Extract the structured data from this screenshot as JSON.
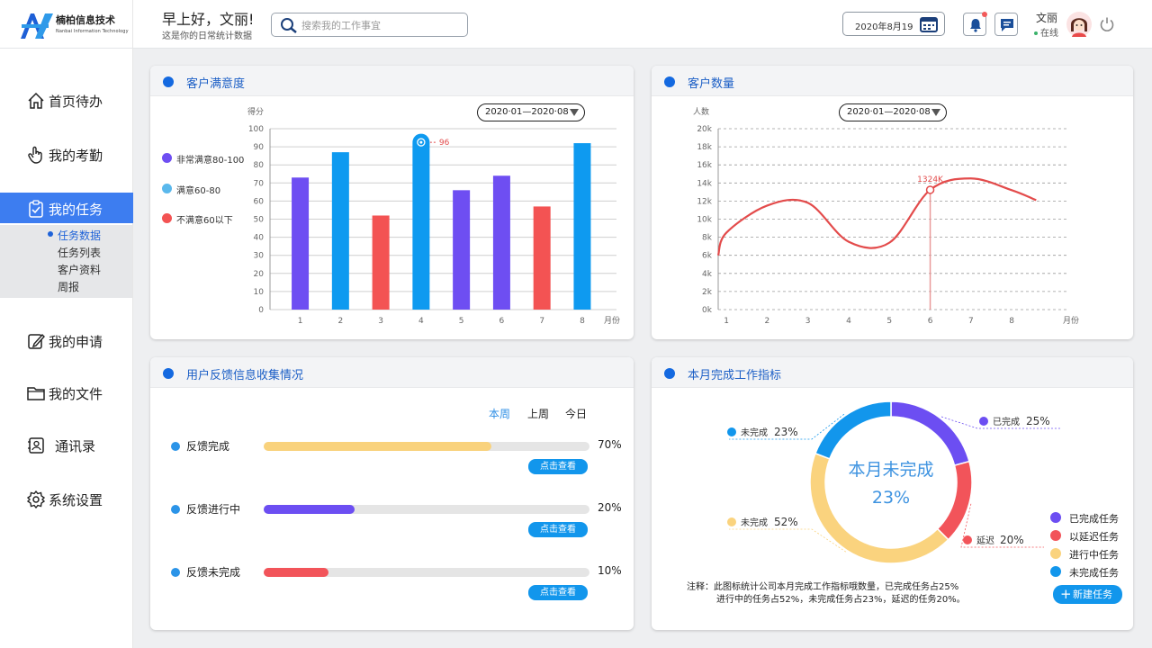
{
  "header": {
    "logo_name": "楠柏信息技术",
    "logo_sub": "Nanbai Information Technology",
    "greeting": "早上好，文丽!",
    "greeting_sub": "这是你的日常统计数据",
    "search_placeholder": "搜索我的工作事宜",
    "date": "2020年8月19",
    "user_name": "文丽",
    "user_status": "在线",
    "icons": [
      "search-icon",
      "calendar-icon",
      "bell-icon",
      "message-icon",
      "avatar",
      "power-icon"
    ]
  },
  "sidebar": {
    "items": [
      {
        "label": "首页待办",
        "icon": "home-icon"
      },
      {
        "label": "我的考勤",
        "icon": "hand-icon"
      },
      {
        "label": "我的任务",
        "icon": "task-icon"
      },
      {
        "label": "我的申请",
        "icon": "edit-icon"
      },
      {
        "label": "我的文件",
        "icon": "folder-icon"
      },
      {
        "label": "通讯录",
        "icon": "contacts-icon"
      },
      {
        "label": "系统设置",
        "icon": "gear-icon"
      }
    ],
    "active_index": 2,
    "sub_items": [
      "任务数据",
      "任务列表",
      "客户资料",
      "周报"
    ],
    "active_sub": 0
  },
  "cards": {
    "satisfaction": {
      "title": "客户满意度",
      "date_range": "2020·01—2020·08"
    },
    "customers": {
      "title": "客户数量",
      "date_range": "2020·01—2020·08"
    },
    "feedback": {
      "title": "用户反馈信息收集情况"
    },
    "monthly": {
      "title": "本月完成工作指标"
    }
  },
  "chart_data": [
    {
      "type": "bar",
      "title": "客户满意度",
      "ylabel": "得分",
      "xlabel": "月份",
      "categories": [
        "1",
        "2",
        "3",
        "4",
        "5",
        "6",
        "7",
        "8"
      ],
      "values": [
        73,
        87,
        52,
        92,
        66,
        74,
        57,
        92
      ],
      "bar_level": [
        "high",
        "mid",
        "low",
        "mid",
        "high",
        "high",
        "low",
        "mid"
      ],
      "ylim": [
        0,
        100
      ],
      "yticks": [
        "0",
        "10",
        "20",
        "30",
        "40",
        "50",
        "60",
        "70",
        "80",
        "90",
        "100"
      ],
      "highlight": {
        "index": 3,
        "label": "96"
      },
      "legend": [
        {
          "label": "非常满意80-100",
          "color": "#6e4ef2"
        },
        {
          "label": "满意60-80",
          "color": "#5ab8ec"
        },
        {
          "label": "不满意60以下",
          "color": "#f35353"
        }
      ],
      "colors": {
        "high": "#6e4ef2",
        "mid": "#0e9af0",
        "low": "#f35353"
      },
      "grid": true
    },
    {
      "type": "line",
      "title": "客户数量",
      "ylabel": "人数",
      "xlabel": "月份",
      "x": [
        0.8,
        1,
        2,
        3,
        4,
        5,
        6,
        7,
        8,
        8.6
      ],
      "y": [
        6,
        8.5,
        11.5,
        11.8,
        7.5,
        7.4,
        13.24,
        14.5,
        13.2,
        12.1
      ],
      "ylim": [
        0,
        20
      ],
      "xticks": [
        "1",
        "2",
        "3",
        "4",
        "5",
        "6",
        "7",
        "8"
      ],
      "yticks": [
        "0k",
        "2k",
        "4k",
        "6k",
        "8k",
        "10k",
        "12k",
        "14k",
        "16k",
        "18k",
        "20k"
      ],
      "highlight": {
        "x": 6,
        "label": "1324K"
      },
      "color": "#e34b4b",
      "grid": true
    },
    {
      "type": "pie",
      "title": "本月完成工作指标",
      "center_label": "本月未完成",
      "center_value": "23%",
      "slices": [
        {
          "label": "已完成",
          "value": 25,
          "color": "#6c4ef2",
          "pct": "25%",
          "legend": "已完成任务"
        },
        {
          "label": "延迟",
          "value": 20,
          "color": "#f2545a",
          "pct": "20%",
          "legend": "以延迟任务"
        },
        {
          "label": "未完成",
          "value": 52,
          "color": "#fad37e",
          "pct": "52%",
          "legend": "进行中任务"
        },
        {
          "label": "未完成",
          "value": 23,
          "color": "#1296ec",
          "pct": "23%",
          "legend": "未完成任务"
        }
      ]
    }
  ],
  "feedback": {
    "tabs": [
      "本周",
      "上周",
      "今日"
    ],
    "active_tab": 0,
    "rows": [
      {
        "label": "反馈完成",
        "pct": "70%",
        "value": 0.7,
        "color": "#f9d27c",
        "button": "点击查看"
      },
      {
        "label": "反馈进行中",
        "pct": "20%",
        "value": 0.28,
        "color": "#6c4ef2",
        "button": "点击查看"
      },
      {
        "label": "反馈未完成",
        "pct": "10%",
        "value": 0.2,
        "color": "#f2545a",
        "button": "点击查看"
      }
    ]
  },
  "monthly": {
    "note_prefix": "注释：",
    "note_line1": "此图标统计公司本月完成工作指标哦数量，已完成任务占25%",
    "note_line2": "进行中的任务占52%，未完成任务占23%，延迟的任务20%。",
    "new_task": "新建任务",
    "new_task_icon": "plus-icon"
  }
}
